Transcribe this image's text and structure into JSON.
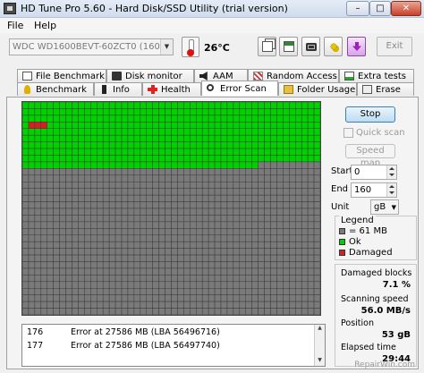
{
  "window": {
    "title": "HD Tune Pro 5.60 - Hard Disk/SSD Utility (trial version)",
    "minimize": "–",
    "maximize": "□",
    "close": "✕"
  },
  "menu": {
    "file": "File",
    "help": "Help"
  },
  "toolbar": {
    "drive": "WDC WD1600BEVT-60ZCT0 (160 gB)",
    "temperature": "26°C",
    "exit_label": "Exit",
    "icons": [
      "copy-icon",
      "copy-screen-icon",
      "camera-icon",
      "options-icon",
      "save-icon"
    ]
  },
  "tabs_top": [
    "File Benchmark",
    "Disk monitor",
    "AAM",
    "Random Access",
    "Extra tests"
  ],
  "tabs_bottom": [
    "Benchmark",
    "Info",
    "Health",
    "Error Scan",
    "Folder Usage",
    "Erase"
  ],
  "active_tab": "Error Scan",
  "scan": {
    "grid_cols": 48,
    "grid_rows": 32,
    "total_blocks": 1536,
    "scanned_blocks": 470,
    "damaged": [
      [
        145,
        146,
        147
      ]
    ],
    "colors": {
      "ok": "#00d200",
      "unscanned": "#7a7a7a",
      "damaged": "#d42020"
    }
  },
  "log": {
    "rows": [
      {
        "num": "176",
        "text": "Error at 27586 MB (LBA 56496716)"
      },
      {
        "num": "177",
        "text": "Error at 27586 MB (LBA 56497740)"
      }
    ]
  },
  "controls": {
    "stop_label": "Stop",
    "quick_scan_label": "Quick scan",
    "speed_map_label": "Speed map",
    "start_label": "Start",
    "start_value": "0",
    "end_label": "End",
    "end_value": "160",
    "unit_label": "Unit",
    "unit_value": "gB"
  },
  "legend": {
    "title": "Legend",
    "block_size": "= 61 MB",
    "ok": "Ok",
    "damaged": "Damaged"
  },
  "stats": {
    "damaged_label": "Damaged blocks",
    "damaged_value": "7.1 %",
    "speed_label": "Scanning speed",
    "speed_value": "56.0 MB/s",
    "position_label": "Position",
    "position_value": "53 gB",
    "elapsed_label": "Elapsed time",
    "elapsed_value": "29:44"
  },
  "watermark": "RepairWin.com"
}
